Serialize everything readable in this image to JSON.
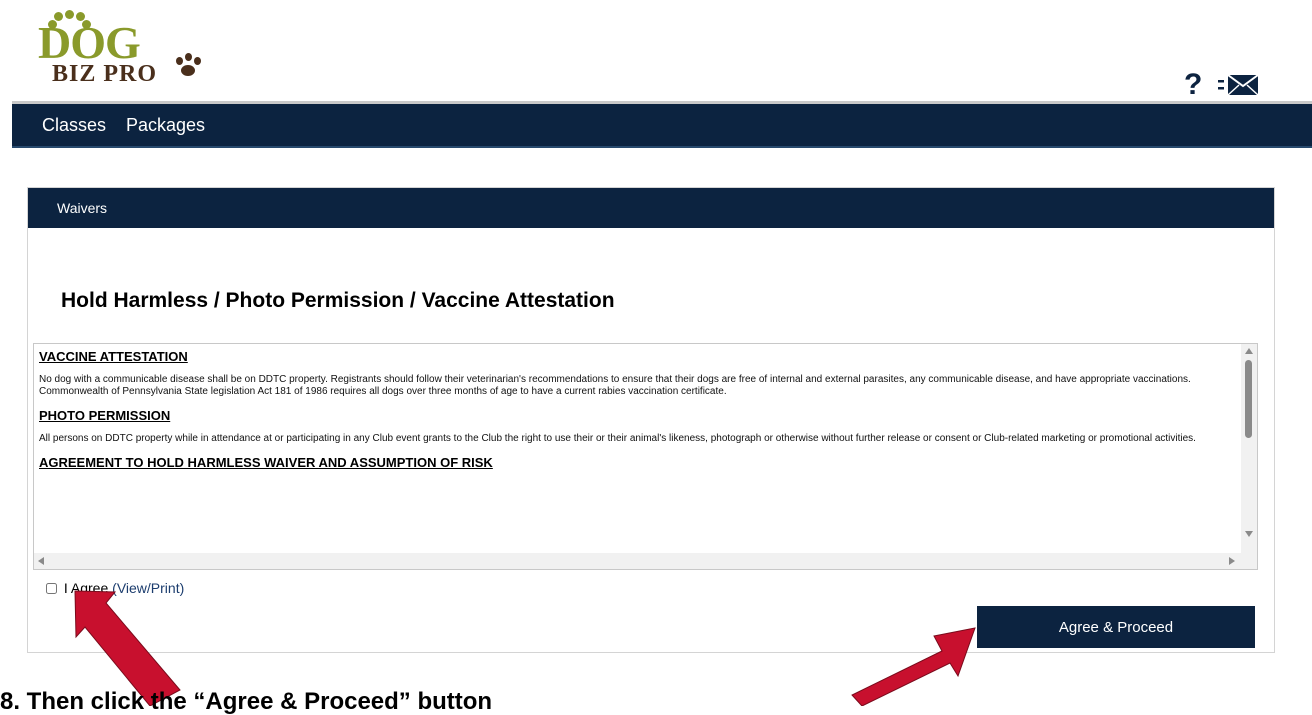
{
  "brand": {
    "logo_top": "DOG",
    "logo_bottom": "BIZ PRO"
  },
  "header": {
    "help_icon": "?",
    "icons": [
      "help-icon",
      "mail-icon"
    ]
  },
  "nav": {
    "items": [
      {
        "label": "Classes"
      },
      {
        "label": "Packages"
      }
    ]
  },
  "panel": {
    "header": "Waivers",
    "title": "Hold Harmless / Photo Permission / Vaccine Attestation",
    "sections": [
      {
        "heading": "VACCINE ATTESTATION",
        "body": "No dog with a communicable disease shall be on DDTC property.  Registrants should follow their veterinarian's recommendations to ensure that their dogs are free of internal and external parasites, any communicable disease, and have appropriate vaccinations.  Commonwealth of Pennsylvania State legislation Act 181 of 1986 requires all dogs over three months of age to have a current rabies vaccination certificate."
      },
      {
        "heading": "PHOTO PERMISSION",
        "body": "All persons on DDTC property while in attendance at or participating in any Club event grants to the Club the right to use their or their animal's likeness, photograph or otherwise without further release or consent or Club-related marketing or promotional activities."
      },
      {
        "heading": "AGREEMENT TO HOLD HARMLESS WAIVER AND ASSUMPTION OF RISK",
        "body": ""
      }
    ],
    "agree_label": "I Agree",
    "view_print_label": "(View/Print)",
    "agree_checked": false,
    "proceed_button": "Agree & Proceed"
  },
  "caption": "8. Then click the “Agree & Proceed” button",
  "colors": {
    "navy": "#0c2340",
    "logo_green": "#8a9a2b",
    "logo_brown": "#4a2f1c",
    "arrow_red": "#c8102e"
  }
}
